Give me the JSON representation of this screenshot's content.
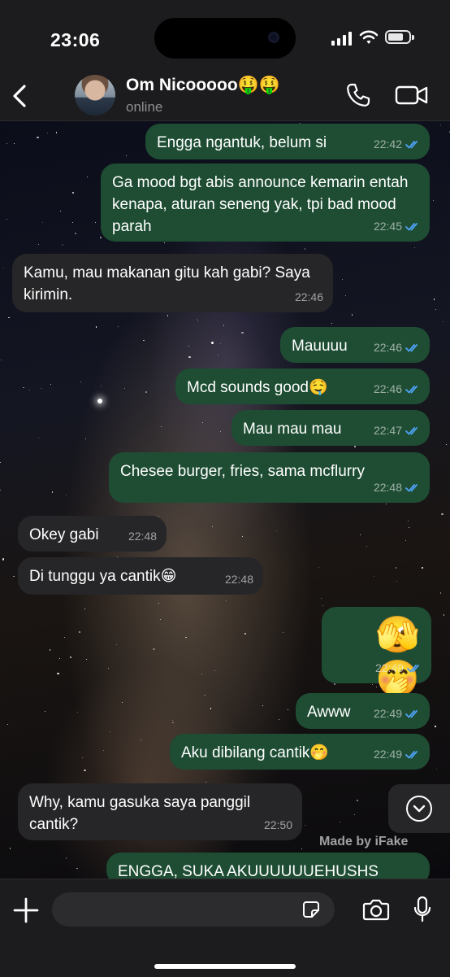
{
  "status_bar": {
    "time": "23:06"
  },
  "header": {
    "back_label": "",
    "contact_name": "Om Nicooooo🤑🤑",
    "contact_status": "online"
  },
  "messages": [
    {
      "dir": "out",
      "text": "Engga ngantuk, belum si",
      "time": "22:42",
      "read": true
    },
    {
      "dir": "out",
      "text": "Ga mood bgt abis announce kemarin entah kenapa, aturan seneng yak, tpi bad mood parah",
      "time": "22:45",
      "read": true
    },
    {
      "dir": "in",
      "text": "Kamu, mau makanan gitu kah gabi? Saya kirimin.",
      "time": "22:46"
    },
    {
      "dir": "out",
      "text": "Mauuuu",
      "time": "22:46",
      "read": true
    },
    {
      "dir": "out",
      "text": "Mcd sounds good🤤",
      "time": "22:46",
      "read": true
    },
    {
      "dir": "out",
      "text": "Mau mau mau",
      "time": "22:47",
      "read": true
    },
    {
      "dir": "out",
      "text": "Chesee burger, fries, sama mcflurry",
      "time": "22:48",
      "read": true
    },
    {
      "dir": "in",
      "text": "Okey gabi",
      "time": "22:48"
    },
    {
      "dir": "in",
      "text": "Di tunggu ya cantik😁",
      "time": "22:48"
    },
    {
      "dir": "out",
      "text": "🫣🤭",
      "time": "22:49",
      "read": true
    },
    {
      "dir": "out",
      "text": "Awww",
      "time": "22:49",
      "read": true
    },
    {
      "dir": "out",
      "text": "Aku dibilang cantik🤭",
      "time": "22:49",
      "read": true
    },
    {
      "dir": "in",
      "text": "Why, kamu gasuka saya panggil cantik?",
      "time": "22:50"
    },
    {
      "dir": "out",
      "text": "ENGGA, SUKA AKUUUUUUEHUSHS",
      "time": "",
      "read": true
    }
  ],
  "watermark": "Made by iFake",
  "input": {
    "placeholder": ""
  },
  "colors": {
    "outgoing_bubble": "#1e4d33",
    "incoming_bubble": "#262628",
    "read_check": "#4fa3f7",
    "bar_bg": "#1c1c1e"
  },
  "icons": [
    "back-chevron-icon",
    "phone-icon",
    "video-camera-icon",
    "scroll-down-icon",
    "plus-icon",
    "sticker-icon",
    "camera-icon",
    "microphone-icon"
  ]
}
